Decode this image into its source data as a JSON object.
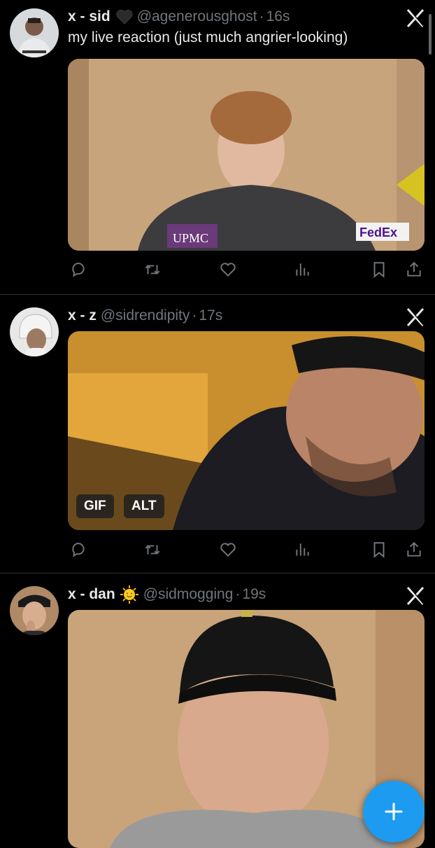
{
  "tweets": [
    {
      "name": "x - sid",
      "emoji": "black heart",
      "handle": "@agenerousghost",
      "separator": "·",
      "time": "16s",
      "text": "my live reaction (just much angrier-looking)",
      "media_badges": [],
      "media_labels": {
        "sponsor1": "UPMC",
        "sponsor2": "FedEx"
      }
    },
    {
      "name": "x - z",
      "handle": "@sidrendipity",
      "separator": "·",
      "time": "17s",
      "text": "",
      "media_badges": [
        "GIF",
        "ALT"
      ]
    },
    {
      "name": "x - dan",
      "emoji": "sun face",
      "handle": "@sidmogging",
      "separator": "·",
      "time": "19s",
      "text": ""
    }
  ],
  "icons": {
    "reply": "reply-icon",
    "retweet": "retweet-icon",
    "like": "like-icon",
    "views": "views-icon",
    "bookmark": "bookmark-icon",
    "share": "share-icon",
    "grok": "grok-x-icon",
    "compose": "plus-icon"
  },
  "colors": {
    "background": "#000000",
    "text": "#e7e9ea",
    "muted": "#71767b",
    "divider": "#2f3336",
    "accent": "#1d9bf0"
  }
}
